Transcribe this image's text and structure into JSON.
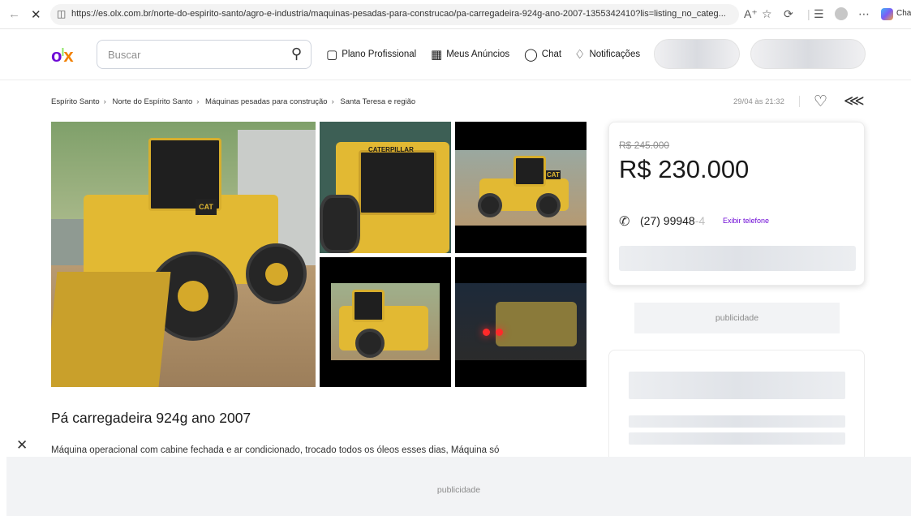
{
  "browser": {
    "url": "https://es.olx.com.br/norte-do-espirito-santo/agro-e-industria/maquinas-pesadas-para-construcao/pa-carregadeira-924g-ano-2007-1355342410?lis=listing_no_categ...",
    "tab_label": "Cha"
  },
  "header": {
    "search_placeholder": "Buscar",
    "nav": [
      "Plano Profissional",
      "Meus Anúncios",
      "Chat",
      "Notificações"
    ]
  },
  "breadcrumb": [
    "Espírito Santo",
    "Norte do Espírito Santo",
    "Máquinas pesadas para construção",
    "Santa Teresa e região"
  ],
  "listing": {
    "date": "29/04 às 21:32",
    "title": "Pá carregadeira 924g ano 2007",
    "description": "Máquina operacional com cabine fechada e ar condicionado, trocado todos os óleos esses dias, Máquina  só",
    "photo_brand_text": "CATERPILLAR",
    "photo_model_text": "CAT"
  },
  "price": {
    "old": "R$ 245.000",
    "current": "R$ 230.000",
    "phone_visible": "(27) 99948",
    "phone_faded": "-4",
    "show_phone": "Exibir telefone"
  },
  "ads": {
    "label": "publicidade"
  },
  "colors": {
    "olx_purple": "#6e0ad6",
    "olx_orange": "#f28000",
    "olx_green": "#8ce563"
  }
}
